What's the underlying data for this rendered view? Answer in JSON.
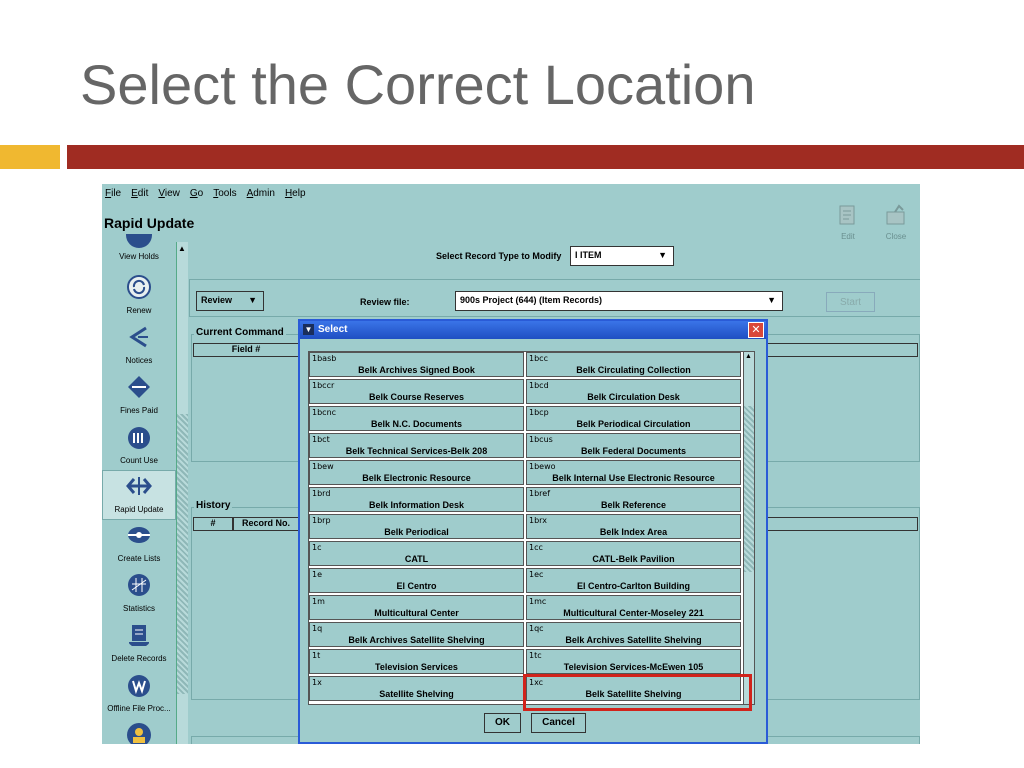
{
  "slide": {
    "title": "Select the Correct Location"
  },
  "app": {
    "menu": [
      "File",
      "Edit",
      "View",
      "Go",
      "Tools",
      "Admin",
      "Help"
    ],
    "title": "Rapid Update",
    "toolbar": {
      "edit_label": "Edit",
      "close_label": "Close"
    },
    "sidebar": [
      "View Holds",
      "Renew",
      "Notices",
      "Fines Paid",
      "Count Use",
      "Rapid Update",
      "Create Lists",
      "Statistics",
      "Delete Records",
      "Offline File Proc..."
    ],
    "sidebar_active": "Rapid Update",
    "record_type_label": "Select Record Type to Modify",
    "record_type_value": "I ITEM",
    "mode_value": "Review",
    "review_file_label": "Review file:",
    "review_file_value": "900s Project (644) (Item Records)",
    "start_label": "Start",
    "current_command_label": "Current Command",
    "field_col": "Field #",
    "history_label": "History",
    "history_cols": [
      "#",
      "Record No."
    ]
  },
  "dialog": {
    "title": "Select",
    "locations": [
      {
        "code": "1basb",
        "name": "Belk Archives Signed Book"
      },
      {
        "code": "1bcc",
        "name": "Belk Circulating Collection"
      },
      {
        "code": "1bccr",
        "name": "Belk Course Reserves"
      },
      {
        "code": "1bcd",
        "name": "Belk Circulation Desk"
      },
      {
        "code": "1bcnc",
        "name": "Belk N.C. Documents"
      },
      {
        "code": "1bcp",
        "name": "Belk Periodical Circulation"
      },
      {
        "code": "1bct",
        "name": "Belk Technical Services-Belk 208"
      },
      {
        "code": "1bcus",
        "name": "Belk Federal Documents"
      },
      {
        "code": "1bew",
        "name": "Belk Electronic Resource"
      },
      {
        "code": "1bewo",
        "name": "Belk Internal Use Electronic Resource"
      },
      {
        "code": "1brd",
        "name": "Belk Information Desk"
      },
      {
        "code": "1bref",
        "name": "Belk Reference"
      },
      {
        "code": "1brp",
        "name": "Belk Periodical"
      },
      {
        "code": "1brx",
        "name": "Belk Index Area"
      },
      {
        "code": "1c",
        "name": "CATL"
      },
      {
        "code": "1cc",
        "name": "CATL-Belk Pavilion"
      },
      {
        "code": "1e",
        "name": "El Centro"
      },
      {
        "code": "1ec",
        "name": "El Centro-Carlton Building"
      },
      {
        "code": "1m",
        "name": "Multicultural Center"
      },
      {
        "code": "1mc",
        "name": "Multicultural Center-Moseley 221"
      },
      {
        "code": "1q",
        "name": "Belk Archives Satellite Shelving"
      },
      {
        "code": "1qc",
        "name": "Belk Archives Satellite Shelving"
      },
      {
        "code": "1t",
        "name": "Television Services"
      },
      {
        "code": "1tc",
        "name": "Television Services-McEwen 105"
      },
      {
        "code": "1x",
        "name": "Satellite Shelving"
      },
      {
        "code": "1xc",
        "name": "Belk Satellite Shelving"
      }
    ],
    "highlighted": "1xc",
    "ok_label": "OK",
    "cancel_label": "Cancel"
  }
}
